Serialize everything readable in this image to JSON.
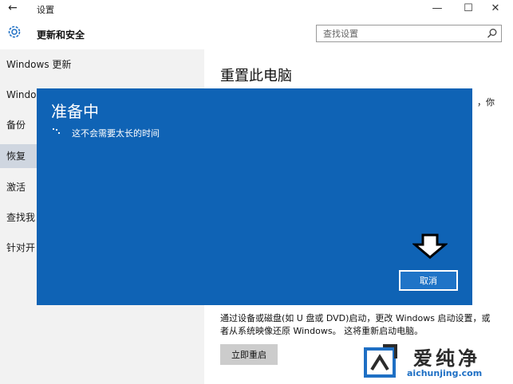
{
  "window": {
    "title": "设置",
    "back_icon": "back-arrow-icon",
    "min_label": "—",
    "max_label": "☐",
    "close_label": "✕"
  },
  "header": {
    "section_title": "更新和安全",
    "icon": "gear-icon",
    "search_placeholder": "查找设置",
    "search_icon": "search-icon"
  },
  "sidebar": {
    "items": [
      {
        "label": "Windows 更新",
        "active": false
      },
      {
        "label": "Windo",
        "active": false
      },
      {
        "label": "备份",
        "active": false
      },
      {
        "label": "恢复",
        "active": true
      },
      {
        "label": "激活",
        "active": false
      },
      {
        "label": "查找我",
        "active": false
      },
      {
        "label": "针对开",
        "active": false
      }
    ]
  },
  "content": {
    "title": "重置此电脑",
    "peek_text": "，你",
    "description": "通过设备或磁盘(如 U 盘或 DVD)启动，更改 Windows 启动设置，或者从系统映像还原 Windows。 这将重新启动电脑。",
    "restart_label": "立即重启"
  },
  "dialog": {
    "title": "准备中",
    "message": "这不会需要太长的时间",
    "cancel_label": "取消",
    "background": "#0f63b5"
  },
  "watermark": {
    "brand": "爱纯净",
    "url": "aichunjing.com"
  }
}
